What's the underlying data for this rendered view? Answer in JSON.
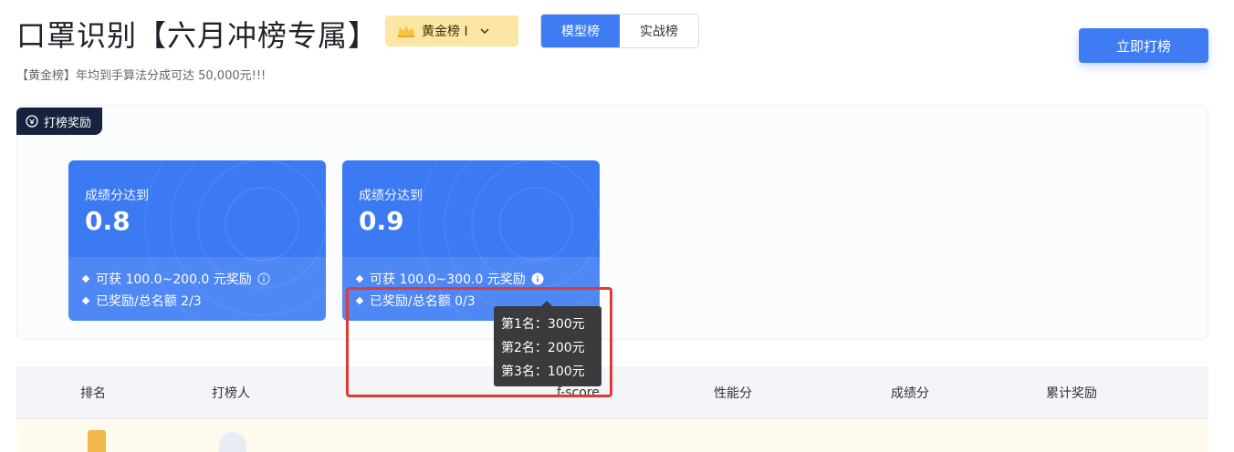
{
  "header": {
    "title": "口罩识别【六月冲榜专属】",
    "rank_select": {
      "value": "黄金榜 I"
    },
    "tabs": [
      {
        "label": "模型榜",
        "active": true
      },
      {
        "label": "实战榜",
        "active": false
      }
    ],
    "primary_button": "立即打榜",
    "subtitle": "【黄金榜】年均到手算法分成可达 50,000元!!!"
  },
  "reward_panel": {
    "tag": "打榜奖励",
    "cards": [
      {
        "label": "成绩分达到",
        "value": "0.8",
        "reward": "可获 100.0~200.0 元奖励",
        "quota": "已奖励/总名额 2/3"
      },
      {
        "label": "成绩分达到",
        "value": "0.9",
        "reward": "可获 100.0~300.0 元奖励",
        "quota": "已奖励/总名额 0/3"
      }
    ],
    "tooltip": {
      "rows": [
        "第1名：300元",
        "第2名：200元",
        "第3名：100元"
      ]
    }
  },
  "table": {
    "columns": [
      "排名",
      "打榜人",
      "f-score",
      "性能分",
      "成绩分",
      "累计奖励"
    ]
  },
  "colors": {
    "primary": "#3f7cf3",
    "card": "#3b7af3",
    "gold": "#fbe7a3",
    "tag_bg": "#15233f",
    "highlight": "#e23a33",
    "tooltip_bg": "#3a3b3d"
  }
}
